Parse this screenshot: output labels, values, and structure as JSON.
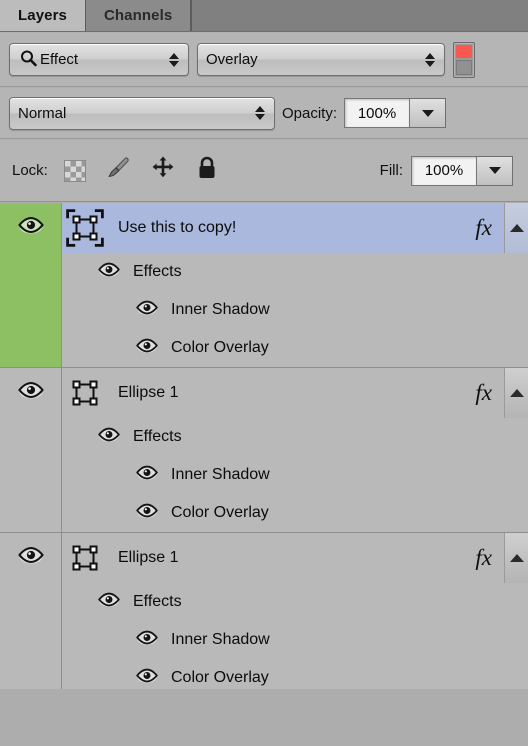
{
  "panel": {
    "tabs": [
      {
        "label": "Layers",
        "active": true
      },
      {
        "label": "Channels",
        "active": false
      }
    ]
  },
  "toolbar": {
    "filter_icon": "search-icon",
    "filter_type": "Effect",
    "filter_value": "Overlay",
    "filter_toggle": {
      "name": "filter-enable-toggle",
      "state": "on",
      "color": "#f9584f"
    },
    "blend_mode": "Normal",
    "opacity_label": "Opacity:",
    "opacity_value": "100%",
    "lock_label": "Lock:",
    "lock_icons": [
      "lock-transparent-pixels-icon",
      "lock-image-pixels-icon",
      "lock-position-icon",
      "lock-all-icon"
    ],
    "fill_label": "Fill:",
    "fill_value": "100%"
  },
  "colors": {
    "selected_row": "#a9b8dc",
    "visible_eye_column": "#8dc063",
    "panel_bg": "#b9b9b9",
    "toolbar_bg": "#b5b5b5",
    "tabbar_bg": "#808080",
    "toggle_red": "#f9584f"
  },
  "layers": [
    {
      "name": "Use this to copy!",
      "selected": true,
      "visible": true,
      "eye_highlighted": true,
      "has_fx": true,
      "fx_label": "fx",
      "thumbnail": "shape-path-thumbnail-selected",
      "effects_label": "Effects",
      "effects": [
        {
          "label": "Inner Shadow",
          "visible": true
        },
        {
          "label": "Color Overlay",
          "visible": true
        }
      ]
    },
    {
      "name": "Ellipse 1",
      "selected": false,
      "visible": true,
      "eye_highlighted": false,
      "has_fx": true,
      "fx_label": "fx",
      "thumbnail": "shape-path-thumbnail",
      "effects_label": "Effects",
      "effects": [
        {
          "label": "Inner Shadow",
          "visible": true
        },
        {
          "label": "Color Overlay",
          "visible": true
        }
      ]
    },
    {
      "name": "Ellipse 1",
      "selected": false,
      "visible": true,
      "eye_highlighted": false,
      "has_fx": true,
      "fx_label": "fx",
      "thumbnail": "shape-path-thumbnail",
      "effects_label": "Effects",
      "effects": [
        {
          "label": "Inner Shadow",
          "visible": true
        },
        {
          "label": "Color Overlay",
          "visible": true
        }
      ]
    }
  ]
}
